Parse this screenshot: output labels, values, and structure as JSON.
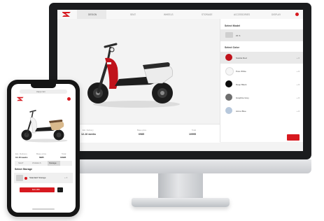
{
  "desktop": {
    "nav": {
      "items": [
        "DESIGN",
        "SEAT",
        "WHEELS",
        "STORAGE",
        "ACCESSORIES",
        "DISPLAY"
      ]
    },
    "sidebar": {
      "model_heading": "Select Model",
      "model_option": {
        "name": "Z1 S",
        "price": "",
        "selected": true
      },
      "color_heading": "Select Color",
      "colors": [
        {
          "name": "Scarlet Red",
          "price": "+ 0",
          "hex": "#c0121b",
          "selected": true
        },
        {
          "name": "Pure White",
          "price": "+ 0",
          "hex": "#f6f6f6",
          "selected": false
        },
        {
          "name": "Deep Black",
          "price": "+ 0",
          "hex": "#0c0c0c",
          "selected": false
        },
        {
          "name": "Graphite Grey",
          "price": "+ 0",
          "hex": "#6e6e6e",
          "selected": false
        },
        {
          "name": "Azure Blue",
          "price": "+ 0",
          "hex": "#b7c8dc",
          "selected": false
        }
      ]
    },
    "specs": [
      {
        "label": "Est. Delivery",
        "value": "12-16 weeks"
      },
      {
        "label": "Base price",
        "value": "6985"
      },
      {
        "label": "Total",
        "value": "10995"
      }
    ]
  },
  "phone": {
    "url": "zapp.com",
    "specs": [
      {
        "label": "Est. Delivery",
        "value": "12-16 weeks"
      },
      {
        "label": "Base price",
        "value": "6985"
      },
      {
        "label": "Total",
        "value": "10995"
      }
    ],
    "tabs": [
      "SEAT",
      "WHEELS",
      "Storage"
    ],
    "section_heading": "Select Storage",
    "option": {
      "name": "Standard Storage",
      "price": "+ 0"
    },
    "total": "$10,995"
  },
  "brand": {
    "accent": "#d7191f"
  }
}
